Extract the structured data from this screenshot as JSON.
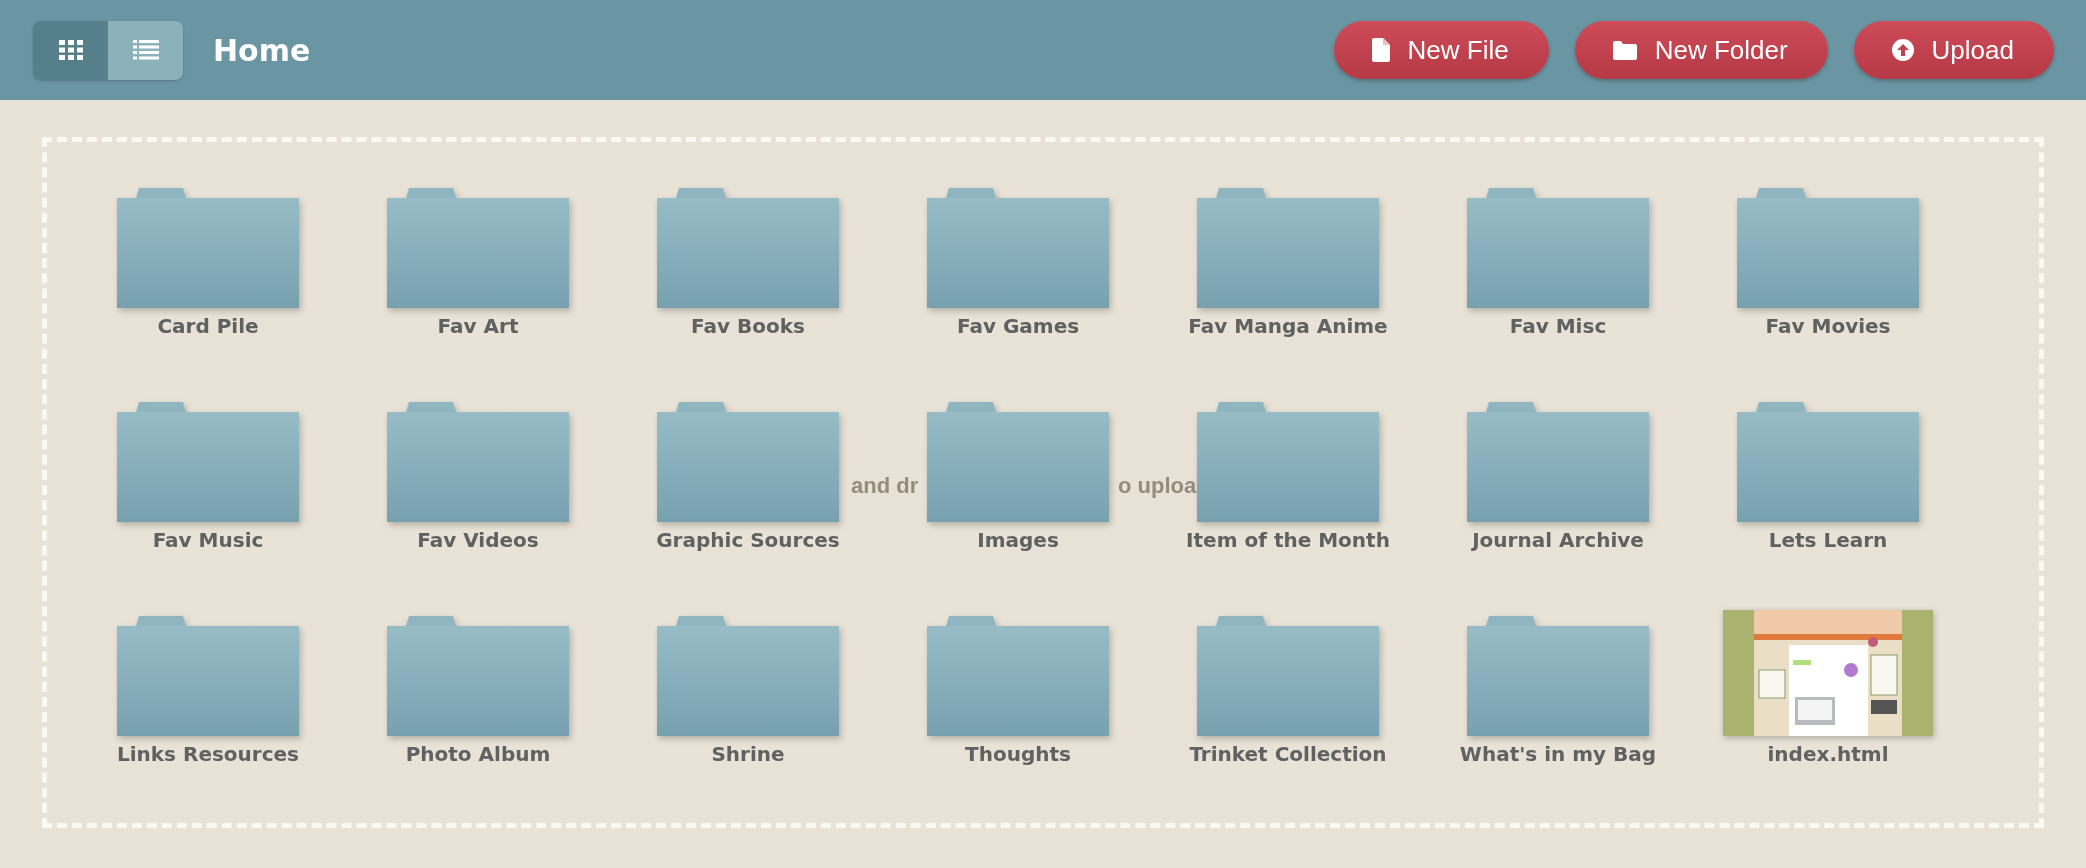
{
  "toolbar": {
    "view_toggle": [
      {
        "kind": "grid",
        "selected": true
      },
      {
        "kind": "list",
        "selected": false
      }
    ],
    "title": "Home",
    "buttons": [
      {
        "kind": "file",
        "label": "New File"
      },
      {
        "kind": "folder",
        "label": "New Folder"
      },
      {
        "kind": "upload",
        "label": "Upload"
      }
    ]
  },
  "drop_zone": {
    "hint_fragments": [
      "and dr",
      "o uploa"
    ]
  },
  "items": [
    {
      "kind": "folder",
      "name": "Card Pile"
    },
    {
      "kind": "folder",
      "name": "Fav Art"
    },
    {
      "kind": "folder",
      "name": "Fav Books"
    },
    {
      "kind": "folder",
      "name": "Fav Games"
    },
    {
      "kind": "folder",
      "name": "Fav Manga Anime"
    },
    {
      "kind": "folder",
      "name": "Fav Misc"
    },
    {
      "kind": "folder",
      "name": "Fav Movies"
    },
    {
      "kind": "folder",
      "name": "Fav Music"
    },
    {
      "kind": "folder",
      "name": "Fav Videos"
    },
    {
      "kind": "folder",
      "name": "Graphic Sources"
    },
    {
      "kind": "folder",
      "name": "Images"
    },
    {
      "kind": "folder",
      "name": "Item of the Month"
    },
    {
      "kind": "folder",
      "name": "Journal Archive"
    },
    {
      "kind": "folder",
      "name": "Lets Learn"
    },
    {
      "kind": "folder",
      "name": "Links Resources"
    },
    {
      "kind": "folder",
      "name": "Photo Album"
    },
    {
      "kind": "folder",
      "name": "Shrine"
    },
    {
      "kind": "folder",
      "name": "Thoughts"
    },
    {
      "kind": "folder",
      "name": "Trinket Collection"
    },
    {
      "kind": "folder",
      "name": "What's in my Bag"
    },
    {
      "kind": "file",
      "name": "index.html"
    }
  ]
}
